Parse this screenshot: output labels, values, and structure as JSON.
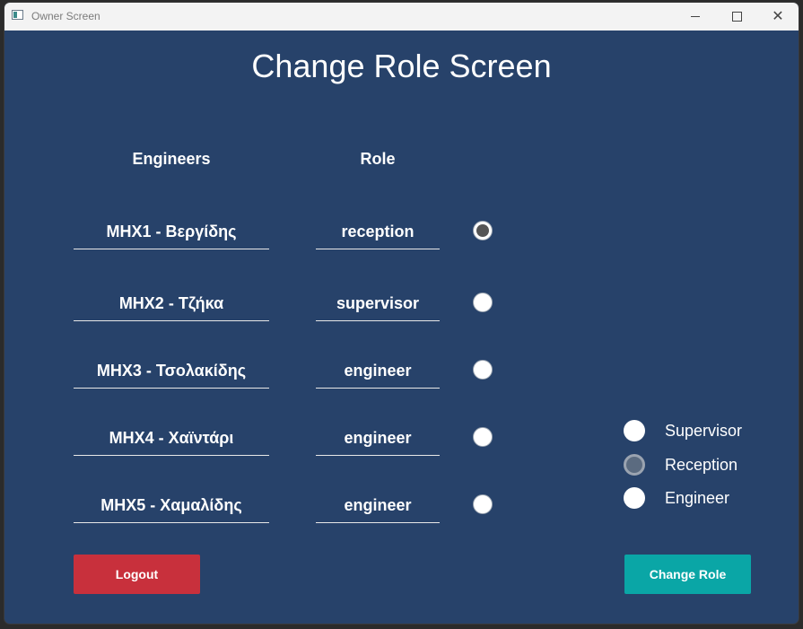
{
  "window": {
    "title": "Owner Screen",
    "controls": {
      "minimize": "",
      "maximize": "",
      "close": "✕"
    }
  },
  "page_title": "Change Role Screen",
  "headers": {
    "engineers": "Engineers",
    "role": "Role"
  },
  "rows": [
    {
      "name": "ΜΗΧ1 - Βεργίδης",
      "role": "reception",
      "selected": true
    },
    {
      "name": "ΜΗΧ2 - Τζήκα",
      "role": "supervisor",
      "selected": false
    },
    {
      "name": "ΜΗΧ3 - Τσολακίδης",
      "role": "engineer",
      "selected": false
    },
    {
      "name": "ΜΗΧ4 - Χαϊντάρι",
      "role": "engineer",
      "selected": false
    },
    {
      "name": "ΜΗΧ5 - Χαμαλίδης",
      "role": "engineer",
      "selected": false
    }
  ],
  "role_options": [
    {
      "label": "Supervisor",
      "state": "unselected"
    },
    {
      "label": "Reception",
      "state": "hover"
    },
    {
      "label": "Engineer",
      "state": "unselected"
    }
  ],
  "buttons": {
    "logout": "Logout",
    "change_role": "Change Role"
  },
  "colors": {
    "background": "#27426a",
    "logout": "#c8303c",
    "change_role": "#0aa6a6"
  }
}
